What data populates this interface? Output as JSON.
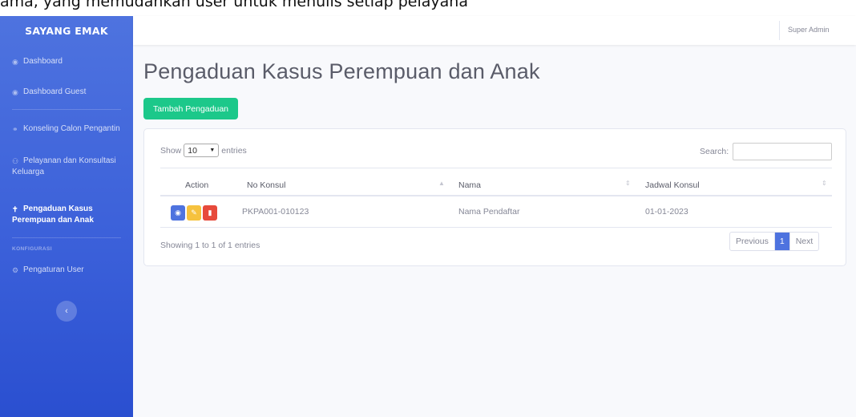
{
  "caption": "ama, yang memudahkan user untuk menulis setiap pelayana",
  "sidebar": {
    "brand": "SAYANG EMAK",
    "items": [
      {
        "label": "Dashboard",
        "icon": "dashboard-icon"
      },
      {
        "label": "Dashboard Guest",
        "icon": "dashboard-icon"
      },
      {
        "label": "Konseling Calon Pengantin",
        "icon": "couple-icon"
      },
      {
        "label_line1": "Pelayanan dan Konsultasi",
        "label_line2": "Keluarga",
        "icon": "users-icon"
      },
      {
        "label_line1": "Pengaduan Kasus",
        "label_line2": "Perempuan dan Anak",
        "icon": "child-icon",
        "active": true
      }
    ],
    "section_heading": "KONFIGURASI",
    "config_items": [
      {
        "label": "Pengaturan User",
        "icon": "cogs-icon"
      }
    ],
    "toggle_icon": "chevron-left-icon"
  },
  "topbar": {
    "user_name": "Super Admin"
  },
  "page": {
    "title": "Pengaduan Kasus Perempuan dan Anak",
    "add_button": "Tambah Pengaduan"
  },
  "table": {
    "length_prefix": "Show",
    "length_value": "10",
    "length_suffix": "entries",
    "search_label": "Search:",
    "search_value": "",
    "columns": [
      "Action",
      "No Konsul",
      "Nama",
      "Jadwal Konsul"
    ],
    "rows": [
      {
        "no_konsul": "PKPA001-010123",
        "nama": "Nama Pendaftar",
        "jadwal": "01-01-2023"
      }
    ],
    "info": "Showing 1 to 1 of 1 entries",
    "pagination": {
      "previous": "Previous",
      "current": "1",
      "next": "Next"
    }
  },
  "colors": {
    "sidebar": "#4e73df",
    "success": "#1cc88a",
    "info": "#4e73df",
    "warning": "#f6c23e",
    "danger": "#e74a3b"
  }
}
